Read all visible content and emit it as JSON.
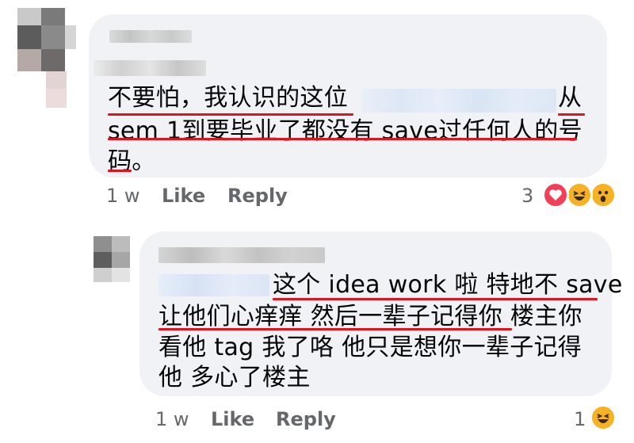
{
  "comments": [
    {
      "text_lines": [
        "不要怕，我认识的这位",
        "从",
        "sem 1到要毕业了都没有 save过任何人的号",
        "码。"
      ],
      "time": "1 w",
      "like_label": "Like",
      "reply_label": "Reply",
      "reaction_count": "3",
      "reactions": [
        "heart-icon",
        "haha-icon",
        "wow-icon"
      ]
    },
    {
      "text_lines": [
        "这个 idea work 啦 特地不 save",
        "让他们心痒痒 然后一辈子记得你 楼主你",
        "看他 tag 我了咯 他只是想你一辈子记得",
        "他 多心了楼主"
      ],
      "time": "1 w",
      "like_label": "Like",
      "reply_label": "Reply",
      "reaction_count": "1",
      "reactions": [
        "haha-icon"
      ]
    }
  ],
  "colors": {
    "bubble": "#f0f2f5",
    "underline": "#e0141e",
    "meta_text": "#65676b",
    "heart": "#f33e58",
    "haha": "#f7b125"
  }
}
